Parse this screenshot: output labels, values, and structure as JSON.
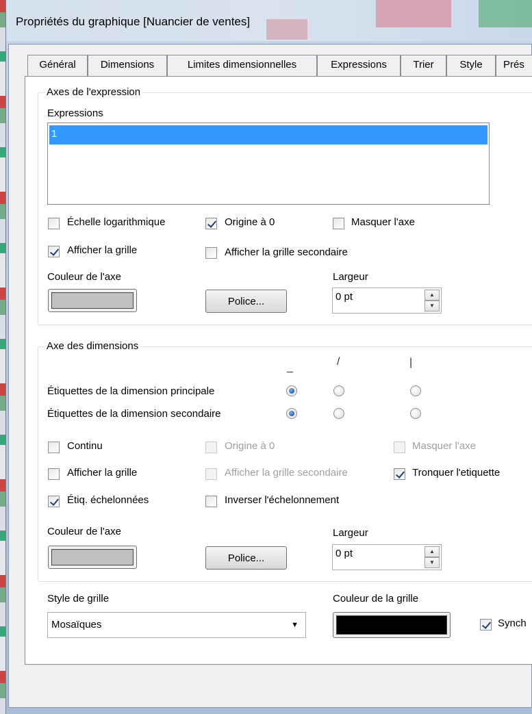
{
  "window": {
    "title": "Propriétés du graphique [Nuancier de ventes]"
  },
  "tabs": [
    {
      "label": "Général"
    },
    {
      "label": "Dimensions"
    },
    {
      "label": "Limites dimensionnelles"
    },
    {
      "label": "Expressions"
    },
    {
      "label": "Trier"
    },
    {
      "label": "Style"
    },
    {
      "label": "Prés"
    }
  ],
  "expression_axes": {
    "group_label": "Axes de l'expression",
    "list_label": "Expressions",
    "list_items": [
      "1"
    ],
    "selected_item": "1",
    "log_scale": {
      "label": "Échelle logarithmique",
      "checked": false
    },
    "origin_zero": {
      "label": "Origine à 0",
      "checked": true
    },
    "hide_axis": {
      "label": "Masquer l'axe",
      "checked": false
    },
    "show_grid": {
      "label": "Afficher la grille",
      "checked": true
    },
    "show_minor_grid": {
      "label": "Afficher la grille secondaire",
      "checked": false
    },
    "axis_color_label": "Couleur de l'axe",
    "axis_color": "#c0c0c0",
    "font_button": "Police...",
    "width_label": "Largeur",
    "width_value": "0 pt"
  },
  "dimension_axis": {
    "group_label": "Axe des dimensions",
    "orientation_headers": [
      "_",
      "/",
      "|"
    ],
    "primary_labels": {
      "label": "Étiquettes de la dimension principale",
      "selected": 0
    },
    "secondary_labels": {
      "label": "Étiquettes de la dimension secondaire",
      "selected": 0
    },
    "continuous": {
      "label": "Continu",
      "checked": false
    },
    "origin_zero": {
      "label": "Origine à 0",
      "checked": false,
      "disabled": true
    },
    "hide_axis": {
      "label": "Masquer l'axe",
      "checked": false,
      "disabled": true
    },
    "show_grid": {
      "label": "Afficher la grille",
      "checked": false
    },
    "show_minor_grid": {
      "label": "Afficher la grille secondaire",
      "checked": false,
      "disabled": true
    },
    "truncate_label": {
      "label": "Tronquer l'etiquette",
      "checked": true
    },
    "staggered_labels": {
      "label": "Étiq. échelonnées",
      "checked": true
    },
    "reverse_stagger": {
      "label": "Inverser l'échelonnement",
      "checked": false
    },
    "axis_color_label": "Couleur de l'axe",
    "axis_color": "#c0c0c0",
    "font_button": "Police...",
    "width_label": "Largeur",
    "width_value": "0 pt"
  },
  "grid": {
    "style_label": "Style de grille",
    "style_value": "Mosaïques",
    "color_label": "Couleur de la grille",
    "color": "#000000",
    "sync_label": "Synch",
    "sync_checked": true
  }
}
